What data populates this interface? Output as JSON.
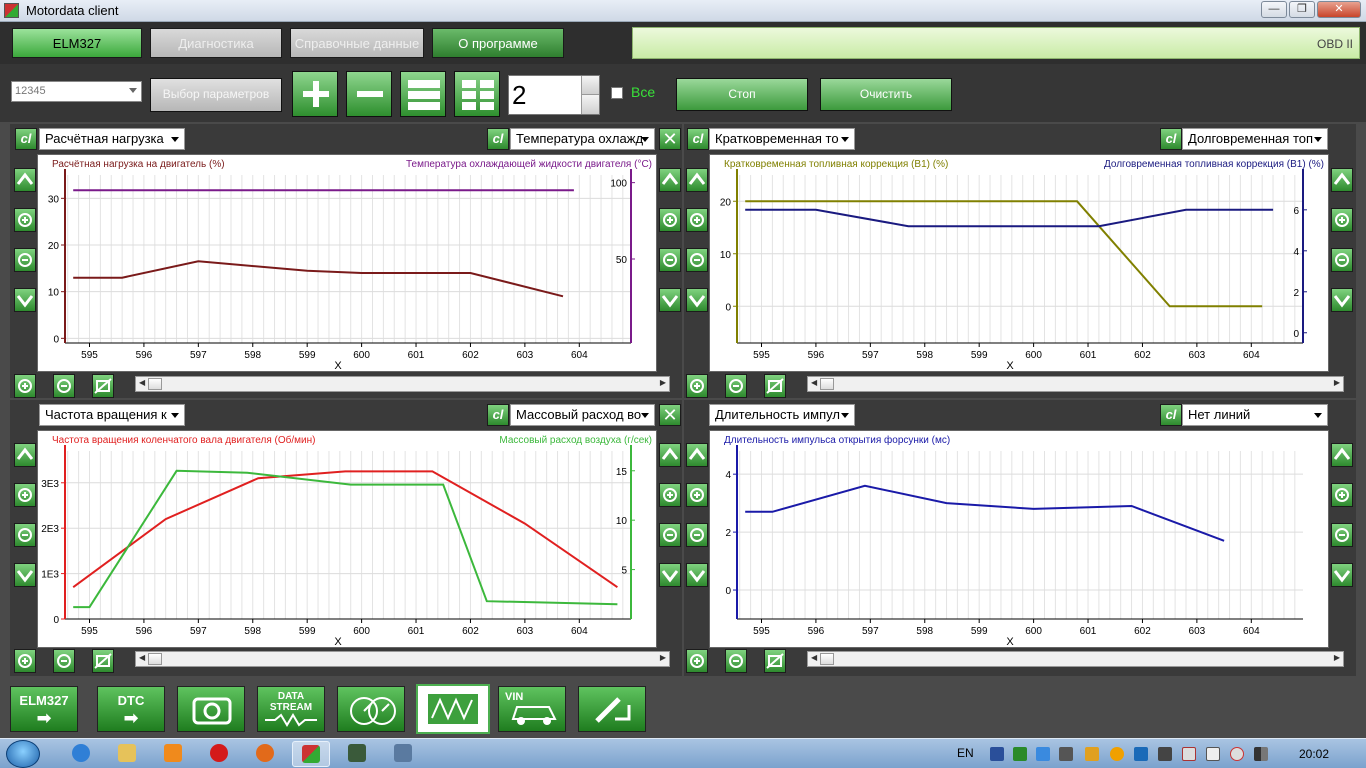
{
  "window": {
    "title": "Motordata client",
    "minimize": "—",
    "maximize": "❐",
    "close": "✕"
  },
  "menu": {
    "items": [
      {
        "label": "ELM327",
        "state": "active"
      },
      {
        "label": "Диагностика",
        "state": "disabled"
      },
      {
        "label": "Справочные данные",
        "state": "disabled"
      },
      {
        "label": "О программе",
        "state": "normal"
      }
    ],
    "obd_label": "OBD II"
  },
  "toolbar": {
    "device_value": "12345",
    "param_select_label": "Выбор параметров",
    "rows_value": "2",
    "all_label": "Все",
    "stop_label": "Стоп",
    "clear_label": "Очистить"
  },
  "panels": {
    "p1": {
      "left_select": "Расчётная нагрузка",
      "right_select": "Температура охлажд",
      "cl": "cl",
      "close": "✕",
      "left_title": "Расчётная нагрузка на двигатель   (%)",
      "right_title": "Температура охлаждающей жидкости двигателя   (°C)",
      "xlabel": "X"
    },
    "p2": {
      "left_select": "Кратковременная то",
      "right_select": "Долговременная топ",
      "cl": "cl",
      "left_title": "Кратковременная топливная коррекция (B1)   (%)",
      "right_title": "Долговременная топливная коррекция (B1)   (%)",
      "xlabel": "X"
    },
    "p3": {
      "left_select": "Частота вращения к",
      "right_select": "Массовый расход во",
      "cl": "cl",
      "close": "✕",
      "left_title": "Частота вращения коленчатого вала двигателя   (Об/мин)",
      "right_title": "Массовый расход воздуха   (г/сек)",
      "xlabel": "X"
    },
    "p4": {
      "left_select": "Длительность импул",
      "right_select": "Нет линий",
      "cl": "cl",
      "left_title": "Длительность импульса открытия форсунки   (мс)",
      "xlabel": "X"
    }
  },
  "dock": {
    "items": [
      {
        "label": "ELM327",
        "icon": "arrow-right-icon"
      },
      {
        "label": "DTC",
        "icon": "arrow-right-icon"
      },
      {
        "label": "",
        "icon": "camera-icon"
      },
      {
        "label": "DATA STREAM",
        "icon": "waveform-icon"
      },
      {
        "label": "",
        "icon": "gauges-icon"
      },
      {
        "label": "",
        "icon": "graph-icon"
      },
      {
        "label": "VIN",
        "icon": "car-icon"
      },
      {
        "label": "",
        "icon": "injector-icon"
      }
    ]
  },
  "taskbar": {
    "lang": "EN",
    "time": "20:02"
  },
  "colors": {
    "load": "#7a1a1a",
    "coolant": "#7a1a8a",
    "stft": "#808000",
    "ltft": "#1a1a80",
    "rpm": "#e02020",
    "maf": "#3cb83c",
    "injector": "#1a1aa8"
  },
  "chart_data": [
    {
      "type": "line",
      "x_ticks": [
        595,
        596,
        597,
        598,
        599,
        600,
        601,
        602,
        603,
        604
      ],
      "xlabel": "X",
      "y_left": {
        "label": "Расчётная нагрузка на двигатель (%)",
        "ticks": [
          0,
          10,
          20,
          30
        ],
        "range": [
          -1,
          35
        ]
      },
      "y_right": {
        "label": "Температура охлаждающей жидкости двигателя (°C)",
        "ticks": [
          50,
          100
        ],
        "range": [
          -5,
          105
        ]
      },
      "series": [
        {
          "name": "Расчётная нагрузка на двигатель",
          "axis": "left",
          "color": "#7a1a1a",
          "x": [
            594.7,
            595.6,
            597.0,
            599.0,
            600.0,
            602.0,
            603.7
          ],
          "y": [
            13,
            13,
            16.5,
            14.5,
            14,
            14,
            9
          ]
        },
        {
          "name": "Температура охлаждающей жидкости двигателя",
          "axis": "right",
          "color": "#7a1a8a",
          "x": [
            594.7,
            603.9
          ],
          "y": [
            95,
            95
          ]
        }
      ]
    },
    {
      "type": "line",
      "x_ticks": [
        595,
        596,
        597,
        598,
        599,
        600,
        601,
        602,
        603,
        604
      ],
      "xlabel": "X",
      "y_left": {
        "label": "Кратковременная топливная коррекция (B1) (%)",
        "ticks": [
          0,
          10,
          20
        ],
        "range": [
          -7,
          25
        ]
      },
      "y_right": {
        "label": "Долговременная топливная коррекция (B1) (%)",
        "ticks": [
          0,
          2,
          4,
          6
        ],
        "range": [
          -0.5,
          7.7
        ]
      },
      "series": [
        {
          "name": "Кратковременная топливная коррекция (B1)",
          "axis": "left",
          "color": "#808000",
          "x": [
            594.7,
            600.8,
            602.5,
            604.2
          ],
          "y": [
            20,
            20,
            0,
            0
          ]
        },
        {
          "name": "Долговременная топливная коррекция (B1)",
          "axis": "right",
          "color": "#1a1a80",
          "x": [
            594.7,
            596.0,
            597.7,
            601.2,
            602.8,
            604.4
          ],
          "y": [
            6,
            6,
            5.2,
            5.2,
            6,
            6
          ]
        }
      ]
    },
    {
      "type": "line",
      "x_ticks": [
        595,
        596,
        597,
        598,
        599,
        600,
        601,
        602,
        603,
        604
      ],
      "xlabel": "X",
      "y_left": {
        "label": "Частота вращения коленчатого вала двигателя (Об/мин)",
        "ticks": [
          0,
          1000,
          2000,
          3000
        ],
        "tick_labels": [
          "0",
          "1E3",
          "2E3",
          "3E3"
        ],
        "range": [
          0,
          3700
        ]
      },
      "y_right": {
        "label": "Массовый расход воздуха (г/сек)",
        "ticks": [
          5,
          10,
          15
        ],
        "range": [
          0,
          17
        ]
      },
      "series": [
        {
          "name": "Частота вращения коленчатого вала двигателя",
          "axis": "left",
          "color": "#e02020",
          "x": [
            594.7,
            596.4,
            598.1,
            599.7,
            601.3,
            603.0,
            604.7
          ],
          "y": [
            700,
            2200,
            3100,
            3250,
            3250,
            2100,
            700
          ]
        },
        {
          "name": "Массовый расход воздуха",
          "axis": "right",
          "color": "#3cb83c",
          "x": [
            594.7,
            595.0,
            596.6,
            597.9,
            599.8,
            601.5,
            602.3,
            604.7
          ],
          "y": [
            1.2,
            1.2,
            15,
            14.8,
            13.6,
            13.6,
            1.8,
            1.5
          ]
        }
      ]
    },
    {
      "type": "line",
      "x_ticks": [
        595,
        596,
        597,
        598,
        599,
        600,
        601,
        602,
        603,
        604
      ],
      "xlabel": "X",
      "y_left": {
        "label": "Длительность импульса открытия форсунки (мс)",
        "ticks": [
          0,
          2,
          4
        ],
        "range": [
          -1,
          4.8
        ]
      },
      "series": [
        {
          "name": "Длительность импульса открытия форсунки",
          "axis": "left",
          "color": "#1a1aa8",
          "x": [
            594.7,
            595.2,
            596.9,
            598.4,
            600.0,
            601.8,
            603.5
          ],
          "y": [
            2.7,
            2.7,
            3.6,
            3.0,
            2.8,
            2.9,
            1.7
          ]
        }
      ]
    }
  ]
}
